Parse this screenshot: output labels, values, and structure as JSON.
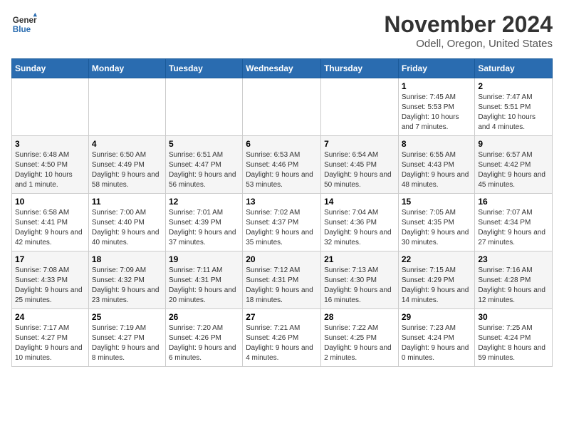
{
  "logo": {
    "general": "General",
    "blue": "Blue"
  },
  "title": "November 2024",
  "location": "Odell, Oregon, United States",
  "days_header": [
    "Sunday",
    "Monday",
    "Tuesday",
    "Wednesday",
    "Thursday",
    "Friday",
    "Saturday"
  ],
  "weeks": [
    [
      {
        "day": "",
        "info": ""
      },
      {
        "day": "",
        "info": ""
      },
      {
        "day": "",
        "info": ""
      },
      {
        "day": "",
        "info": ""
      },
      {
        "day": "",
        "info": ""
      },
      {
        "day": "1",
        "info": "Sunrise: 7:45 AM\nSunset: 5:53 PM\nDaylight: 10 hours and 7 minutes."
      },
      {
        "day": "2",
        "info": "Sunrise: 7:47 AM\nSunset: 5:51 PM\nDaylight: 10 hours and 4 minutes."
      }
    ],
    [
      {
        "day": "3",
        "info": "Sunrise: 6:48 AM\nSunset: 4:50 PM\nDaylight: 10 hours and 1 minute."
      },
      {
        "day": "4",
        "info": "Sunrise: 6:50 AM\nSunset: 4:49 PM\nDaylight: 9 hours and 58 minutes."
      },
      {
        "day": "5",
        "info": "Sunrise: 6:51 AM\nSunset: 4:47 PM\nDaylight: 9 hours and 56 minutes."
      },
      {
        "day": "6",
        "info": "Sunrise: 6:53 AM\nSunset: 4:46 PM\nDaylight: 9 hours and 53 minutes."
      },
      {
        "day": "7",
        "info": "Sunrise: 6:54 AM\nSunset: 4:45 PM\nDaylight: 9 hours and 50 minutes."
      },
      {
        "day": "8",
        "info": "Sunrise: 6:55 AM\nSunset: 4:43 PM\nDaylight: 9 hours and 48 minutes."
      },
      {
        "day": "9",
        "info": "Sunrise: 6:57 AM\nSunset: 4:42 PM\nDaylight: 9 hours and 45 minutes."
      }
    ],
    [
      {
        "day": "10",
        "info": "Sunrise: 6:58 AM\nSunset: 4:41 PM\nDaylight: 9 hours and 42 minutes."
      },
      {
        "day": "11",
        "info": "Sunrise: 7:00 AM\nSunset: 4:40 PM\nDaylight: 9 hours and 40 minutes."
      },
      {
        "day": "12",
        "info": "Sunrise: 7:01 AM\nSunset: 4:39 PM\nDaylight: 9 hours and 37 minutes."
      },
      {
        "day": "13",
        "info": "Sunrise: 7:02 AM\nSunset: 4:37 PM\nDaylight: 9 hours and 35 minutes."
      },
      {
        "day": "14",
        "info": "Sunrise: 7:04 AM\nSunset: 4:36 PM\nDaylight: 9 hours and 32 minutes."
      },
      {
        "day": "15",
        "info": "Sunrise: 7:05 AM\nSunset: 4:35 PM\nDaylight: 9 hours and 30 minutes."
      },
      {
        "day": "16",
        "info": "Sunrise: 7:07 AM\nSunset: 4:34 PM\nDaylight: 9 hours and 27 minutes."
      }
    ],
    [
      {
        "day": "17",
        "info": "Sunrise: 7:08 AM\nSunset: 4:33 PM\nDaylight: 9 hours and 25 minutes."
      },
      {
        "day": "18",
        "info": "Sunrise: 7:09 AM\nSunset: 4:32 PM\nDaylight: 9 hours and 23 minutes."
      },
      {
        "day": "19",
        "info": "Sunrise: 7:11 AM\nSunset: 4:31 PM\nDaylight: 9 hours and 20 minutes."
      },
      {
        "day": "20",
        "info": "Sunrise: 7:12 AM\nSunset: 4:31 PM\nDaylight: 9 hours and 18 minutes."
      },
      {
        "day": "21",
        "info": "Sunrise: 7:13 AM\nSunset: 4:30 PM\nDaylight: 9 hours and 16 minutes."
      },
      {
        "day": "22",
        "info": "Sunrise: 7:15 AM\nSunset: 4:29 PM\nDaylight: 9 hours and 14 minutes."
      },
      {
        "day": "23",
        "info": "Sunrise: 7:16 AM\nSunset: 4:28 PM\nDaylight: 9 hours and 12 minutes."
      }
    ],
    [
      {
        "day": "24",
        "info": "Sunrise: 7:17 AM\nSunset: 4:27 PM\nDaylight: 9 hours and 10 minutes."
      },
      {
        "day": "25",
        "info": "Sunrise: 7:19 AM\nSunset: 4:27 PM\nDaylight: 9 hours and 8 minutes."
      },
      {
        "day": "26",
        "info": "Sunrise: 7:20 AM\nSunset: 4:26 PM\nDaylight: 9 hours and 6 minutes."
      },
      {
        "day": "27",
        "info": "Sunrise: 7:21 AM\nSunset: 4:26 PM\nDaylight: 9 hours and 4 minutes."
      },
      {
        "day": "28",
        "info": "Sunrise: 7:22 AM\nSunset: 4:25 PM\nDaylight: 9 hours and 2 minutes."
      },
      {
        "day": "29",
        "info": "Sunrise: 7:23 AM\nSunset: 4:24 PM\nDaylight: 9 hours and 0 minutes."
      },
      {
        "day": "30",
        "info": "Sunrise: 7:25 AM\nSunset: 4:24 PM\nDaylight: 8 hours and 59 minutes."
      }
    ]
  ]
}
